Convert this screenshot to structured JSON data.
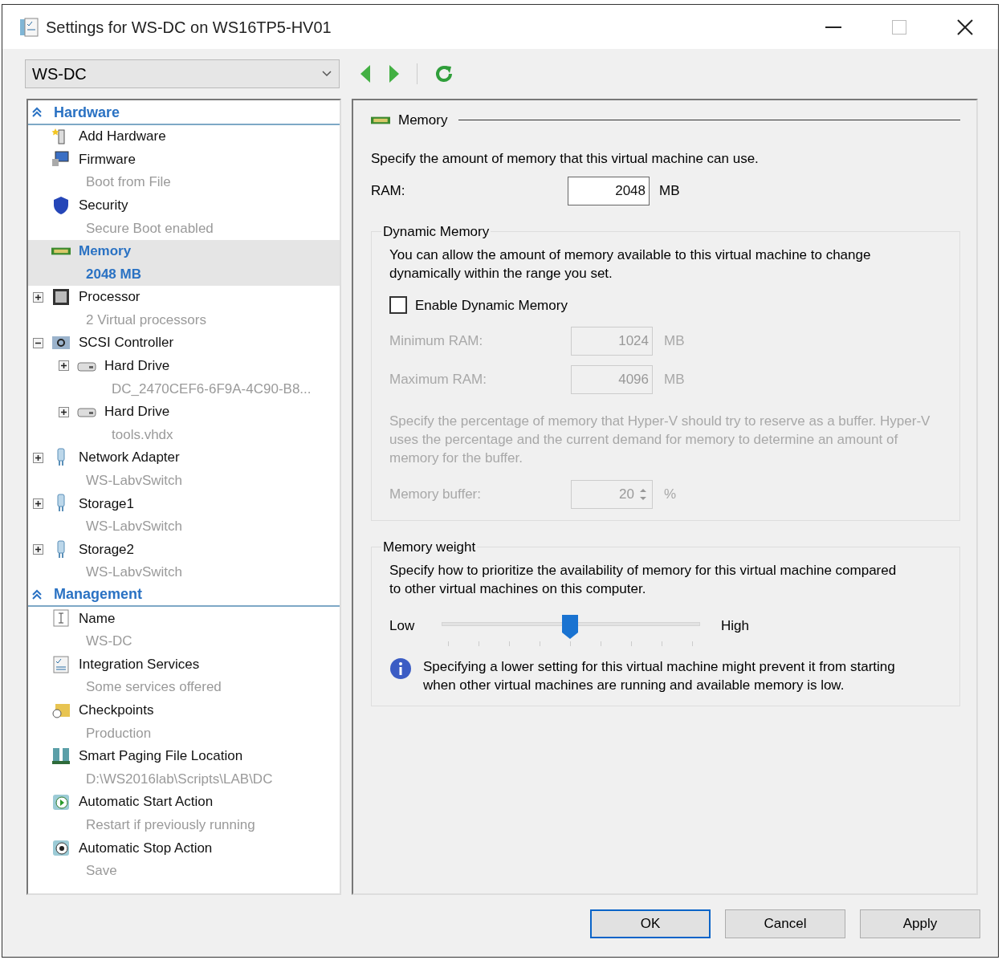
{
  "window": {
    "title": "Settings for WS-DC on WS16TP5-HV01"
  },
  "vm_select": {
    "value": "WS-DC"
  },
  "sidebar": {
    "sections": [
      {
        "title": "Hardware",
        "expanded": true,
        "items": [
          {
            "kind": "add",
            "label": "Add Hardware",
            "selected": false
          },
          {
            "kind": "firmware",
            "label": "Firmware",
            "detail": "Boot from File",
            "selected": false
          },
          {
            "kind": "security",
            "label": "Security",
            "detail": "Secure Boot enabled",
            "selected": false
          },
          {
            "kind": "memory",
            "label": "Memory",
            "detail": "2048 MB",
            "selected": true
          },
          {
            "kind": "processor",
            "label": "Processor",
            "detail": "2 Virtual processors",
            "selected": false,
            "expanded": false
          },
          {
            "kind": "scsi",
            "label": "SCSI Controller",
            "selected": false,
            "expanded": true,
            "children": [
              {
                "kind": "drive",
                "label": "Hard Drive",
                "detail": "DC_2470CEF6-6F9A-4C90-B8...",
                "selected": false,
                "expanded": false
              },
              {
                "kind": "drive",
                "label": "Hard Drive",
                "detail": "tools.vhdx",
                "selected": false,
                "expanded": false
              }
            ]
          },
          {
            "kind": "network",
            "label": "Network Adapter",
            "detail": "WS-LabvSwitch",
            "selected": false,
            "expanded": false
          },
          {
            "kind": "network",
            "label": "Storage1",
            "detail": "WS-LabvSwitch",
            "selected": false,
            "expanded": false
          },
          {
            "kind": "network",
            "label": "Storage2",
            "detail": "WS-LabvSwitch",
            "selected": false,
            "expanded": false
          }
        ]
      },
      {
        "title": "Management",
        "expanded": true,
        "items": [
          {
            "kind": "name",
            "label": "Name",
            "detail": "WS-DC",
            "selected": false
          },
          {
            "kind": "integration",
            "label": "Integration Services",
            "detail": "Some services offered",
            "selected": false
          },
          {
            "kind": "checkpoints",
            "label": "Checkpoints",
            "detail": "Production",
            "selected": false
          },
          {
            "kind": "paging",
            "label": "Smart Paging File Location",
            "detail": "D:\\WS2016lab\\Scripts\\LAB\\DC",
            "selected": false
          },
          {
            "kind": "start",
            "label": "Automatic Start Action",
            "detail": "Restart if previously running",
            "selected": false
          },
          {
            "kind": "stop",
            "label": "Automatic Stop Action",
            "detail": "Save",
            "selected": false
          }
        ]
      }
    ]
  },
  "memory": {
    "heading": "Memory",
    "description": "Specify the amount of memory that this virtual machine can use.",
    "ram": {
      "label": "RAM:",
      "value": "2048",
      "unit": "MB"
    }
  },
  "dynamic_memory": {
    "title": "Dynamic Memory",
    "description": "You can allow the amount of memory available to this virtual machine to change dynamically within the range you set.",
    "enable": {
      "label": "Enable Dynamic Memory",
      "checked": false
    },
    "fields": [
      {
        "label": "Minimum RAM:",
        "value": "1024",
        "unit": "MB",
        "disabled": true
      },
      {
        "label": "Maximum RAM:",
        "value": "4096",
        "unit": "MB",
        "disabled": true
      }
    ],
    "buffer_note": "Specify the percentage of memory that Hyper-V should try to reserve as a buffer. Hyper-V uses the percentage and the current demand for memory to determine an amount of memory for the buffer.",
    "buffer": {
      "label": "Memory buffer:",
      "value": "20",
      "unit": "%",
      "disabled": true
    }
  },
  "memory_weight": {
    "title": "Memory weight",
    "description": "Specify how to prioritize the availability of memory for this virtual machine compared to other virtual machines on this computer.",
    "low": "Low",
    "high": "High",
    "level": 0.5,
    "note": "Specifying a lower setting for this virtual machine might prevent it from starting when other virtual machines are running and available memory is low."
  },
  "buttons": [
    {
      "label": "OK",
      "default": true
    },
    {
      "label": "Cancel",
      "default": false
    },
    {
      "label": "Apply",
      "default": false
    }
  ]
}
